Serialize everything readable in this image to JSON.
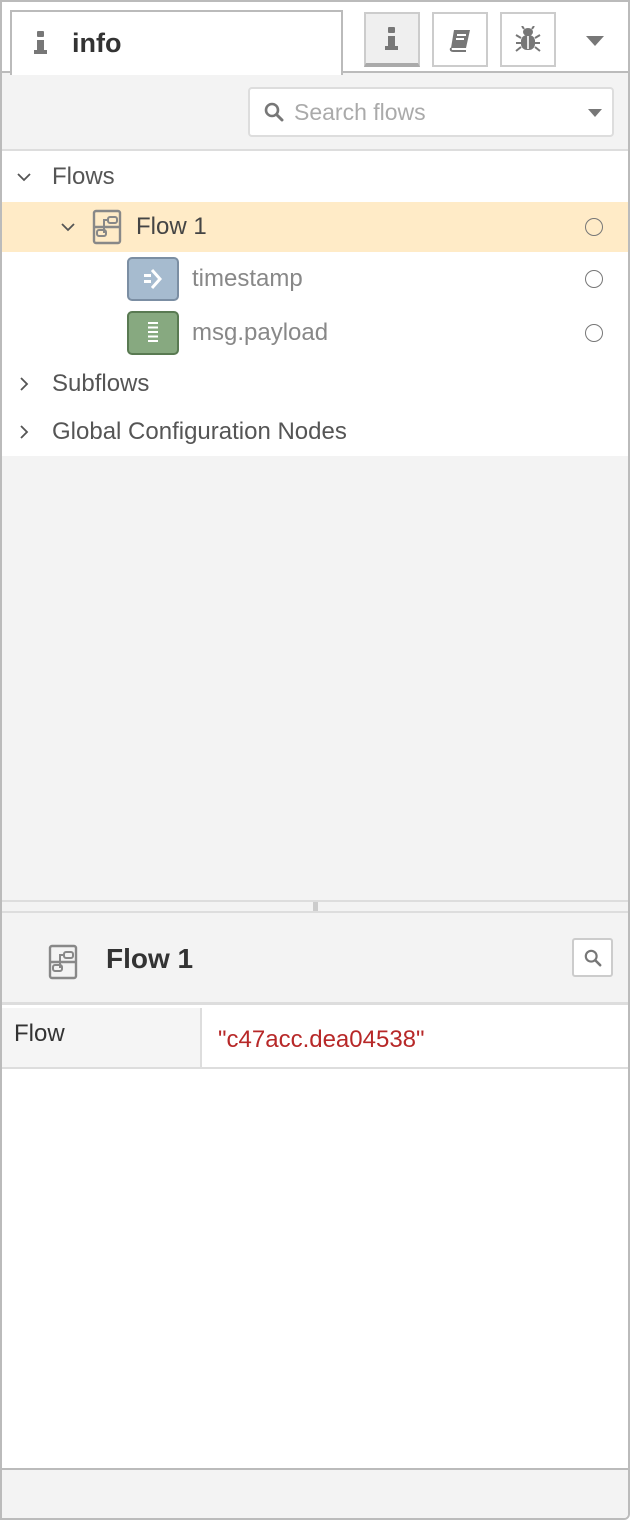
{
  "sidebar": {
    "active_tab": {
      "label": "info",
      "icon": "info-icon"
    },
    "toolbar_buttons": [
      {
        "name": "info",
        "icon": "info-icon",
        "active": true
      },
      {
        "name": "help",
        "icon": "book-icon",
        "active": false
      },
      {
        "name": "debug",
        "icon": "bug-icon",
        "active": false
      }
    ],
    "menu_icon": "caret-down-icon"
  },
  "search": {
    "placeholder": "Search flows",
    "value": "",
    "icon": "search-icon"
  },
  "tree": {
    "sections": [
      {
        "label": "Flows",
        "expanded": true,
        "children": [
          {
            "label": "Flow 1",
            "icon": "flow-icon",
            "expanded": true,
            "selected": true,
            "status": "circle-icon",
            "children": [
              {
                "label": "timestamp",
                "type": "inject",
                "icon": "arrow-in-icon",
                "color": "#a6bbcf",
                "status": "circle-icon"
              },
              {
                "label": "msg.payload",
                "type": "debug",
                "icon": "list-lines-icon",
                "color": "#87a980",
                "status": "circle-icon"
              }
            ]
          }
        ]
      },
      {
        "label": "Subflows",
        "expanded": false
      },
      {
        "label": "Global Configuration Nodes",
        "expanded": false
      }
    ]
  },
  "info_panel": {
    "title": "Flow 1",
    "icon": "flow-icon",
    "reveal_icon": "search-icon",
    "properties": [
      {
        "key": "Flow",
        "value": "\"c47acc.dea04538\""
      }
    ]
  },
  "colors": {
    "selected_row": "#ffebc7",
    "property_value": "#b72828",
    "inject_node": "#a6bbcf",
    "debug_node": "#87a980"
  }
}
